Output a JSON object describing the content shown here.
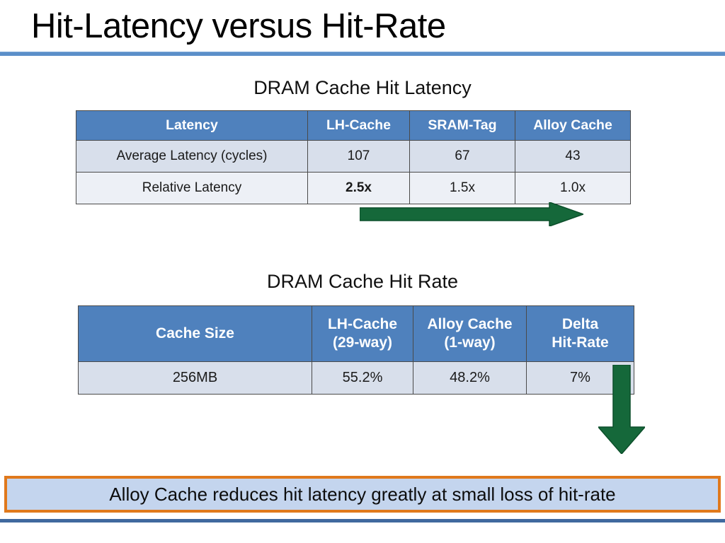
{
  "slide": {
    "title": "Hit-Latency versus Hit-Rate"
  },
  "sections": {
    "latency": {
      "caption": "DRAM Cache Hit Latency"
    },
    "hitrate": {
      "caption": "DRAM Cache Hit Rate"
    }
  },
  "table_latency": {
    "headers": [
      "Latency",
      "LH-Cache",
      "SRAM-Tag",
      "Alloy Cache"
    ],
    "rows": [
      {
        "label": "Average Latency (cycles)",
        "values": [
          "107",
          "67",
          "43"
        ]
      },
      {
        "label": "Relative Latency",
        "values": [
          "2.5x",
          "1.5x",
          "1.0x"
        ]
      }
    ]
  },
  "table_hitrate": {
    "headers": [
      {
        "line1": "Cache Size",
        "line2": ""
      },
      {
        "line1": "LH-Cache",
        "line2": "(29-way)"
      },
      {
        "line1": "Alloy Cache",
        "line2": "(1-way)"
      },
      {
        "line1": "Delta",
        "line2": "Hit-Rate"
      }
    ],
    "rows": [
      {
        "label": "256MB",
        "values": [
          "55.2%",
          "48.2%",
          "7%"
        ]
      }
    ]
  },
  "annotations": {
    "arrow_right_name": "green-right-arrow",
    "arrow_down_name": "green-down-arrow"
  },
  "conclusion": {
    "text": "Alloy Cache reduces hit latency greatly at small loss of hit-rate"
  },
  "colors": {
    "header_blue": "#4f81bd",
    "row_band": "#d8dfeb",
    "row_band_alt": "#edf0f6",
    "accent_red": "#9e1b1b",
    "arrow_green": "#15683a",
    "banner_fill": "#c4d5ee",
    "banner_border": "#e0791c",
    "rule_blue": "#5b8fc9",
    "footer_rule_blue": "#40699e"
  }
}
